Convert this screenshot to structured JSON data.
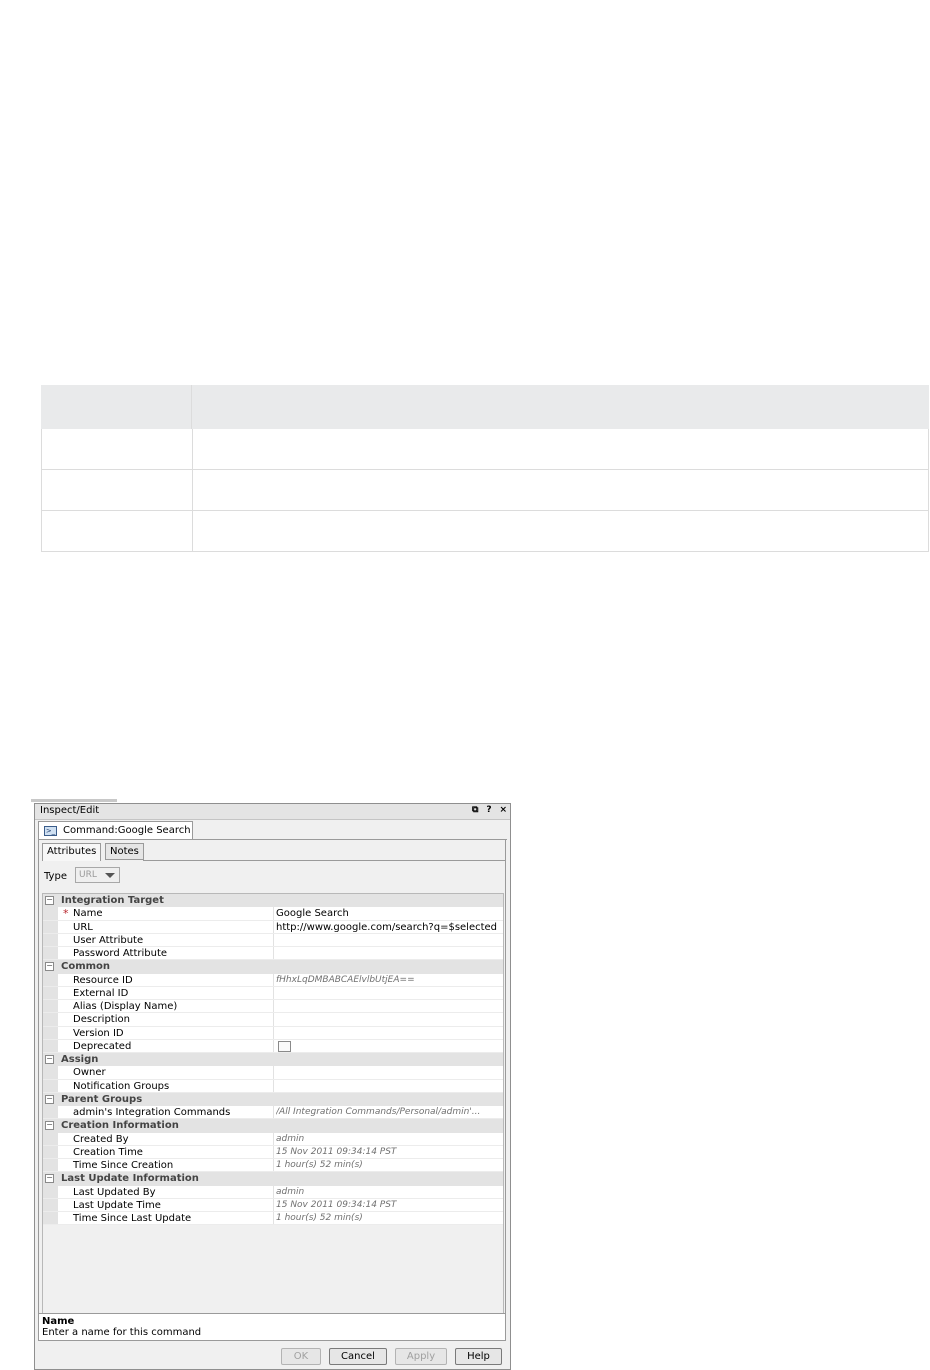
{
  "dialog": {
    "title": "Inspect/Edit",
    "controls": [
      "⧉",
      "?",
      "×"
    ],
    "doc_tab": {
      "label": "Command:Google Search",
      "icon": "command-icon"
    },
    "subtabs": [
      {
        "label": "Attributes",
        "active": true
      },
      {
        "label": "Notes",
        "active": false
      }
    ],
    "type": {
      "label": "Type",
      "value": "URL"
    },
    "grid": [
      {
        "kind": "cat",
        "label": "Integration Target"
      },
      {
        "kind": "prop",
        "label": "Name",
        "value": "Google Search",
        "required": true
      },
      {
        "kind": "prop",
        "label": "URL",
        "value": "http://www.google.com/search?q=$selected"
      },
      {
        "kind": "prop",
        "label": "User Attribute",
        "value": ""
      },
      {
        "kind": "prop",
        "label": "Password Attribute",
        "value": ""
      },
      {
        "kind": "cat",
        "label": "Common"
      },
      {
        "kind": "prop",
        "label": "Resource ID",
        "value": "fHhxLqDMBABCAElvlbUtjEA==",
        "readonly": true
      },
      {
        "kind": "prop",
        "label": "External ID",
        "value": ""
      },
      {
        "kind": "prop",
        "label": "Alias (Display Name)",
        "value": ""
      },
      {
        "kind": "prop",
        "label": "Description",
        "value": ""
      },
      {
        "kind": "prop",
        "label": "Version ID",
        "value": ""
      },
      {
        "kind": "prop",
        "label": "Deprecated",
        "value": "",
        "checkbox": true
      },
      {
        "kind": "cat",
        "label": "Assign"
      },
      {
        "kind": "prop",
        "label": "Owner",
        "value": ""
      },
      {
        "kind": "prop",
        "label": "Notification Groups",
        "value": ""
      },
      {
        "kind": "cat",
        "label": "Parent Groups"
      },
      {
        "kind": "prop",
        "label": "admin's Integration Commands",
        "value": "/All Integration Commands/Personal/admin'...",
        "readonly": true
      },
      {
        "kind": "cat",
        "label": "Creation Information"
      },
      {
        "kind": "prop",
        "label": "Created By",
        "value": "admin",
        "readonly": true
      },
      {
        "kind": "prop",
        "label": "Creation Time",
        "value": "15 Nov 2011 09:34:14 PST",
        "readonly": true
      },
      {
        "kind": "prop",
        "label": "Time Since Creation",
        "value": "1 hour(s) 52 min(s)",
        "readonly": true
      },
      {
        "kind": "cat",
        "label": "Last Update Information"
      },
      {
        "kind": "prop",
        "label": "Last Updated By",
        "value": "admin",
        "readonly": true
      },
      {
        "kind": "prop",
        "label": "Last Update Time",
        "value": "15 Nov 2011 09:34:14 PST",
        "readonly": true
      },
      {
        "kind": "prop",
        "label": "Time Since Last Update",
        "value": "1 hour(s) 52 min(s)",
        "readonly": true
      }
    ],
    "help": {
      "name": "Name",
      "text": "Enter a name for this command"
    },
    "buttons": [
      {
        "label": "OK",
        "disabled": true
      },
      {
        "label": "Cancel",
        "disabled": false
      },
      {
        "label": "Apply",
        "disabled": true
      },
      {
        "label": "Help",
        "disabled": false
      }
    ]
  },
  "colors": {
    "required": "#b8252c",
    "header_fill": "#e9eaeb",
    "category_fill": "#e3e3e3"
  }
}
